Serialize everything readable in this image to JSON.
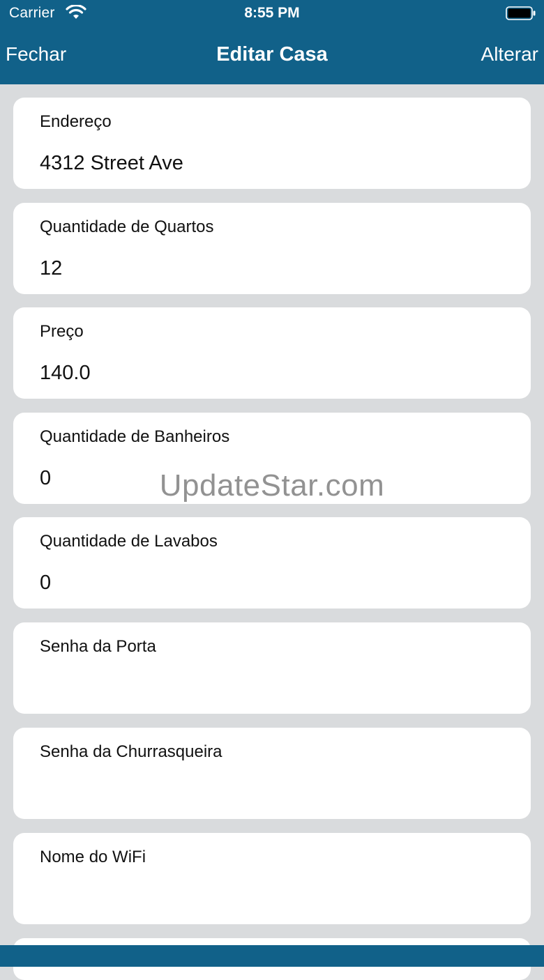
{
  "status_bar": {
    "carrier": "Carrier",
    "time": "8:55 PM",
    "wifi_icon": "wifi-icon",
    "battery_icon": "battery-icon"
  },
  "nav": {
    "left_label": "Fechar",
    "title": "Editar Casa",
    "right_label": "Alterar"
  },
  "fields": [
    {
      "label": "Endereço",
      "value": "4312 Street Ave"
    },
    {
      "label": "Quantidade de Quartos",
      "value": "12"
    },
    {
      "label": "Preço",
      "value": "140.0"
    },
    {
      "label": "Quantidade de Banheiros",
      "value": "0"
    },
    {
      "label": "Quantidade de Lavabos",
      "value": "0"
    },
    {
      "label": "Senha da Porta",
      "value": ""
    },
    {
      "label": "Senha da Churrasqueira",
      "value": ""
    },
    {
      "label": "Nome do WiFi",
      "value": ""
    }
  ],
  "watermark": "UpdateStar.com",
  "colors": {
    "bar": "#116189",
    "background": "#d9dbdd",
    "card": "#ffffff"
  }
}
